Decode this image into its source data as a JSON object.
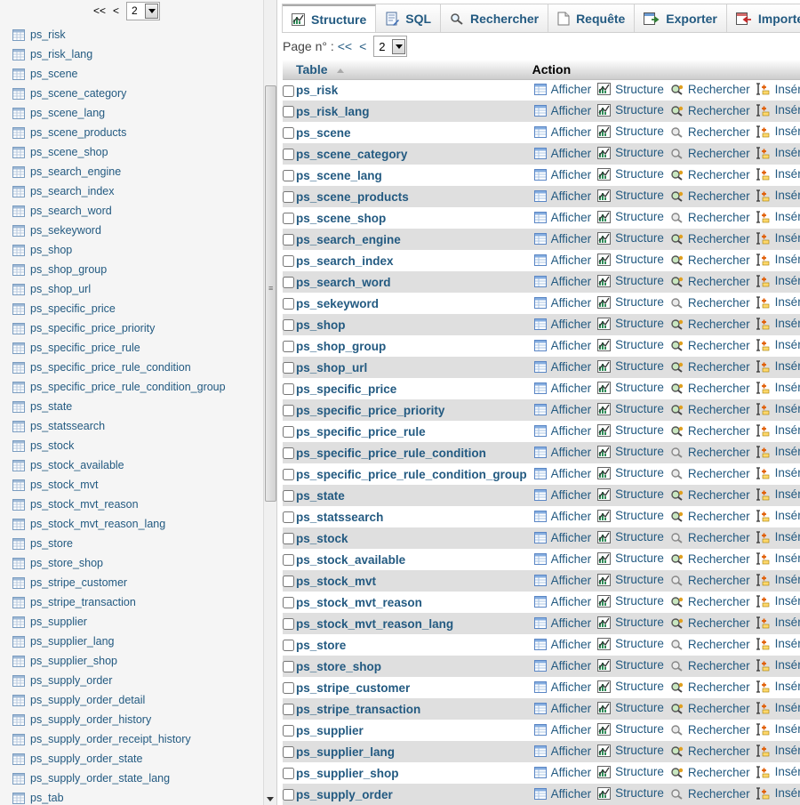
{
  "navigation": {
    "pager": {
      "first": "<<",
      "prev": "<",
      "page": "2"
    },
    "tables": [
      "ps_risk",
      "ps_risk_lang",
      "ps_scene",
      "ps_scene_category",
      "ps_scene_lang",
      "ps_scene_products",
      "ps_scene_shop",
      "ps_search_engine",
      "ps_search_index",
      "ps_search_word",
      "ps_sekeyword",
      "ps_shop",
      "ps_shop_group",
      "ps_shop_url",
      "ps_specific_price",
      "ps_specific_price_priority",
      "ps_specific_price_rule",
      "ps_specific_price_rule_condition",
      "ps_specific_price_rule_condition_group",
      "ps_state",
      "ps_statssearch",
      "ps_stock",
      "ps_stock_available",
      "ps_stock_mvt",
      "ps_stock_mvt_reason",
      "ps_stock_mvt_reason_lang",
      "ps_store",
      "ps_store_shop",
      "ps_stripe_customer",
      "ps_stripe_transaction",
      "ps_supplier",
      "ps_supplier_lang",
      "ps_supplier_shop",
      "ps_supply_order",
      "ps_supply_order_detail",
      "ps_supply_order_history",
      "ps_supply_order_receipt_history",
      "ps_supply_order_state",
      "ps_supply_order_state_lang",
      "ps_tab"
    ]
  },
  "tabs": [
    {
      "label": "Structure",
      "icon": "structure-icon",
      "active": true
    },
    {
      "label": "SQL",
      "icon": "sql-icon"
    },
    {
      "label": "Rechercher",
      "icon": "search-icon"
    },
    {
      "label": "Requête",
      "icon": "query-icon"
    },
    {
      "label": "Exporter",
      "icon": "export-icon"
    },
    {
      "label": "Importer",
      "icon": "import-icon"
    }
  ],
  "pagination": {
    "label": "Page n° :",
    "first": "<<",
    "prev": "<",
    "page": "2"
  },
  "table": {
    "header_table": "Table",
    "header_action": "Action",
    "actions": {
      "browse": "Afficher",
      "structure": "Structure",
      "search": "Rechercher",
      "insert": "Insérer"
    },
    "rows": [
      {
        "name": "ps_risk",
        "search_state": "active"
      },
      {
        "name": "ps_risk_lang",
        "search_state": "active"
      },
      {
        "name": "ps_scene",
        "search_state": "disabled"
      },
      {
        "name": "ps_scene_category",
        "search_state": "disabled"
      },
      {
        "name": "ps_scene_lang",
        "search_state": "active"
      },
      {
        "name": "ps_scene_products",
        "search_state": "active"
      },
      {
        "name": "ps_scene_shop",
        "search_state": "disabled"
      },
      {
        "name": "ps_search_engine",
        "search_state": "active"
      },
      {
        "name": "ps_search_index",
        "search_state": "active"
      },
      {
        "name": "ps_search_word",
        "search_state": "active"
      },
      {
        "name": "ps_sekeyword",
        "search_state": "disabled"
      },
      {
        "name": "ps_shop",
        "search_state": "active"
      },
      {
        "name": "ps_shop_group",
        "search_state": "active"
      },
      {
        "name": "ps_shop_url",
        "search_state": "active"
      },
      {
        "name": "ps_specific_price",
        "search_state": "active"
      },
      {
        "name": "ps_specific_price_priority",
        "search_state": "active"
      },
      {
        "name": "ps_specific_price_rule",
        "search_state": "active"
      },
      {
        "name": "ps_specific_price_rule_condition",
        "search_state": "disabled"
      },
      {
        "name": "ps_specific_price_rule_condition_group",
        "search_state": "disabled"
      },
      {
        "name": "ps_state",
        "search_state": "active"
      },
      {
        "name": "ps_statssearch",
        "search_state": "active"
      },
      {
        "name": "ps_stock",
        "search_state": "disabled"
      },
      {
        "name": "ps_stock_available",
        "search_state": "active"
      },
      {
        "name": "ps_stock_mvt",
        "search_state": "disabled"
      },
      {
        "name": "ps_stock_mvt_reason",
        "search_state": "active"
      },
      {
        "name": "ps_stock_mvt_reason_lang",
        "search_state": "active"
      },
      {
        "name": "ps_store",
        "search_state": "disabled"
      },
      {
        "name": "ps_store_shop",
        "search_state": "disabled"
      },
      {
        "name": "ps_stripe_customer",
        "search_state": "active"
      },
      {
        "name": "ps_stripe_transaction",
        "search_state": "active"
      },
      {
        "name": "ps_supplier",
        "search_state": "disabled"
      },
      {
        "name": "ps_supplier_lang",
        "search_state": "active"
      },
      {
        "name": "ps_supplier_shop",
        "search_state": "active"
      },
      {
        "name": "ps_supply_order",
        "search_state": "disabled"
      }
    ]
  },
  "colors": {
    "link": "#235a81",
    "row_even": "#dfdfdf",
    "row_odd": "#ffffff",
    "nav_bg": "#f5f5f5"
  }
}
